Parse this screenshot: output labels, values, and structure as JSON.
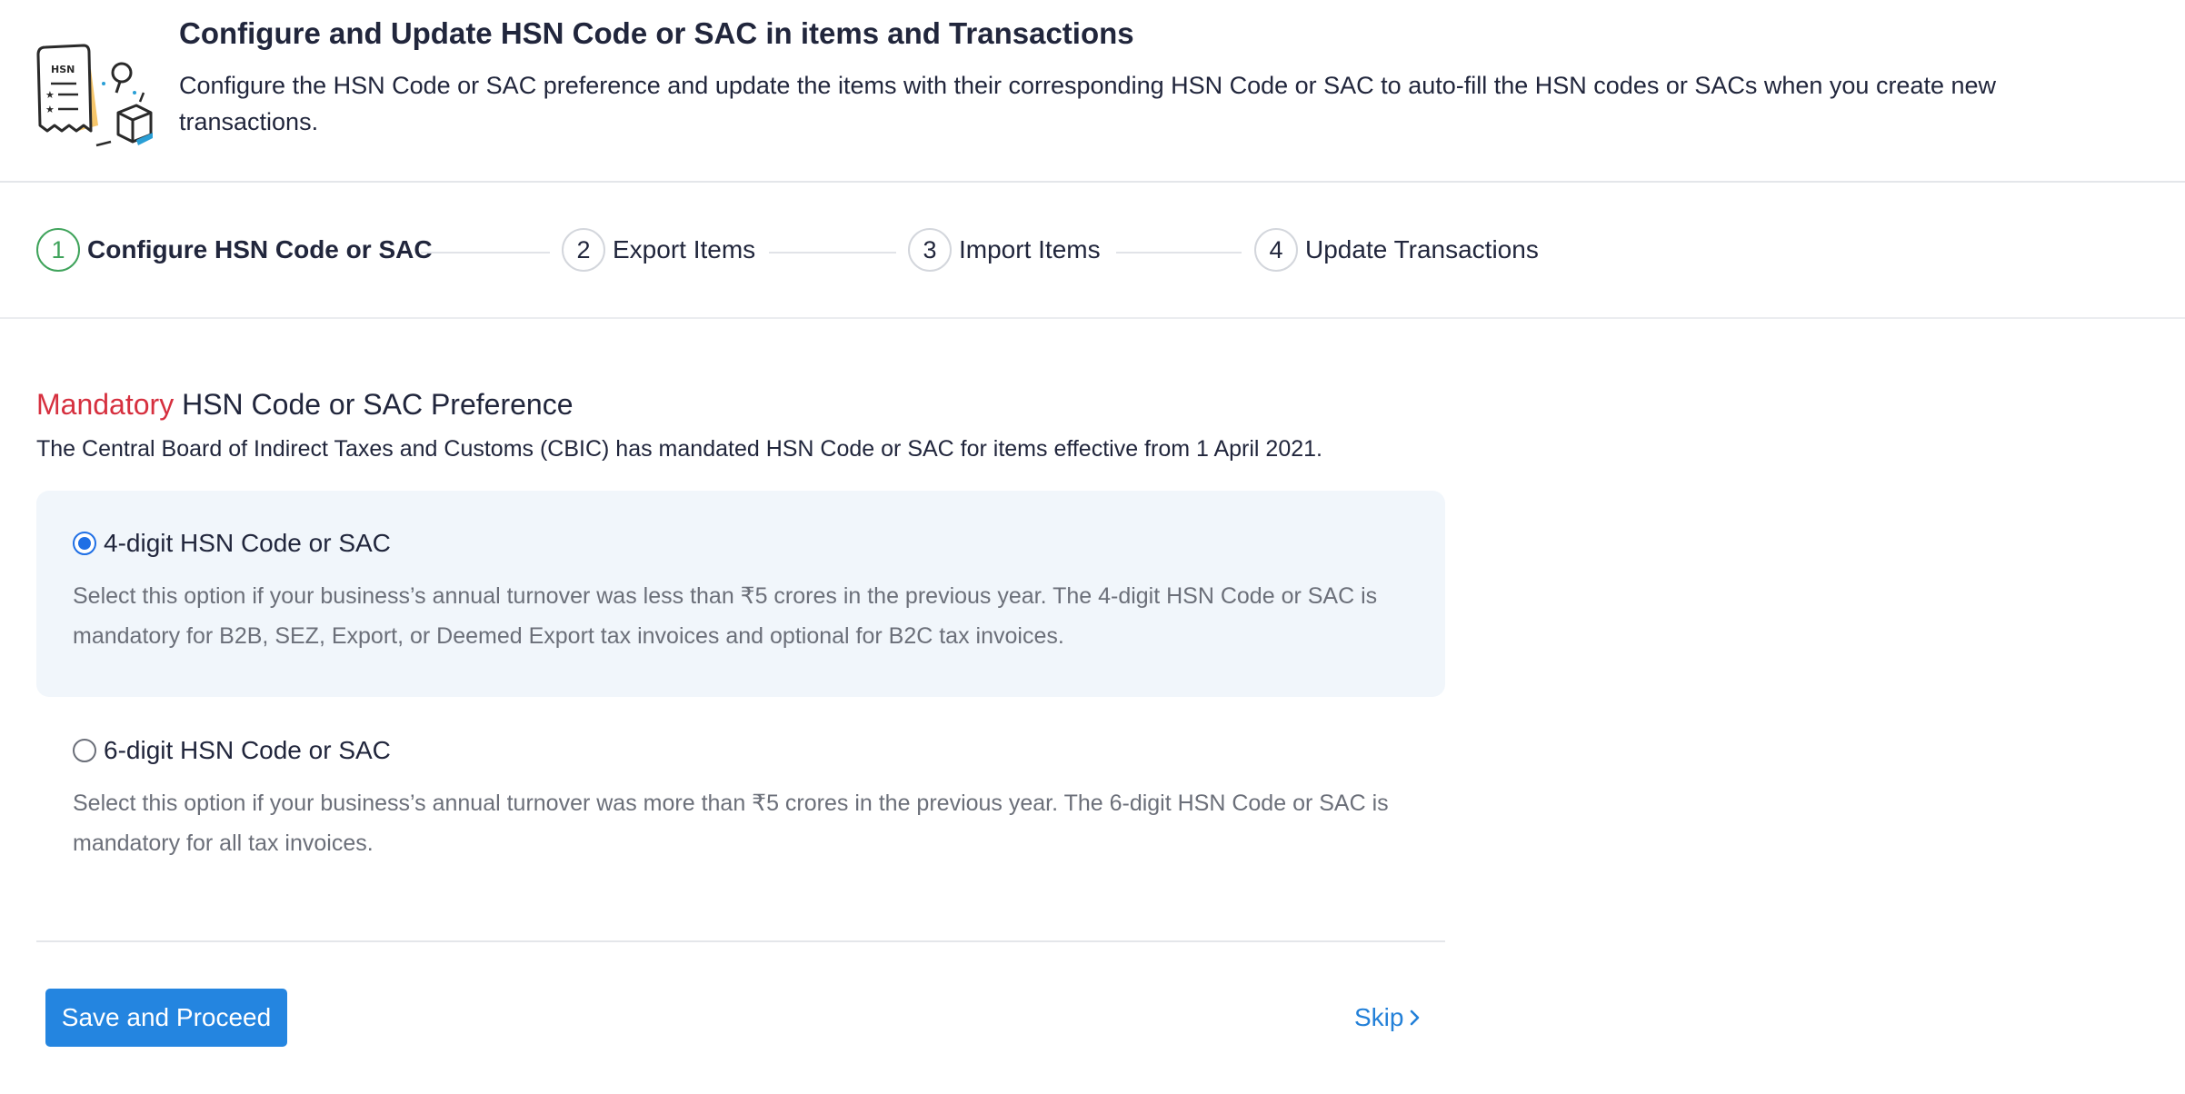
{
  "header": {
    "title": "Configure and Update HSN Code or SAC in items and Transactions",
    "description": "Configure the HSN Code or SAC preference and update the items with their corresponding HSN Code or SAC to auto-fill the HSN codes or SACs when you create new transactions.",
    "illustration_text": "HSN"
  },
  "stepper": {
    "steps": [
      {
        "number": "1",
        "label": "Configure HSN Code or SAC",
        "active": true
      },
      {
        "number": "2",
        "label": "Export Items",
        "active": false
      },
      {
        "number": "3",
        "label": "Import Items",
        "active": false
      },
      {
        "number": "4",
        "label": "Update Transactions",
        "active": false
      }
    ],
    "active_color": "#3fa35b"
  },
  "preference": {
    "title_mandatory": "Mandatory",
    "title_rest": " HSN Code or SAC Preference",
    "description": "The Central Board of Indirect Taxes and Customs (CBIC) has mandated HSN Code or SAC for items effective from 1 April 2021.",
    "options": [
      {
        "label": "4-digit HSN Code or SAC",
        "description": "Select this option if your business’s annual turnover was less than ₹5 crores in the previous year. The 4-digit HSN Code or SAC is mandatory for B2B, SEZ, Export, or Deemed Export tax invoices and optional for B2C tax invoices.",
        "selected": true
      },
      {
        "label": "6-digit HSN Code or SAC",
        "description": "Select this option if your business’s annual turnover was more than ₹5 crores in the previous year. The 6-digit HSN Code or SAC is mandatory for all tax invoices.",
        "selected": false
      }
    ]
  },
  "actions": {
    "save_label": "Save and Proceed",
    "skip_label": "Skip"
  },
  "colors": {
    "primary": "#2485e0",
    "mandatory": "#d6303f",
    "selected_bg": "#f1f6fb",
    "link": "#2380d8"
  }
}
